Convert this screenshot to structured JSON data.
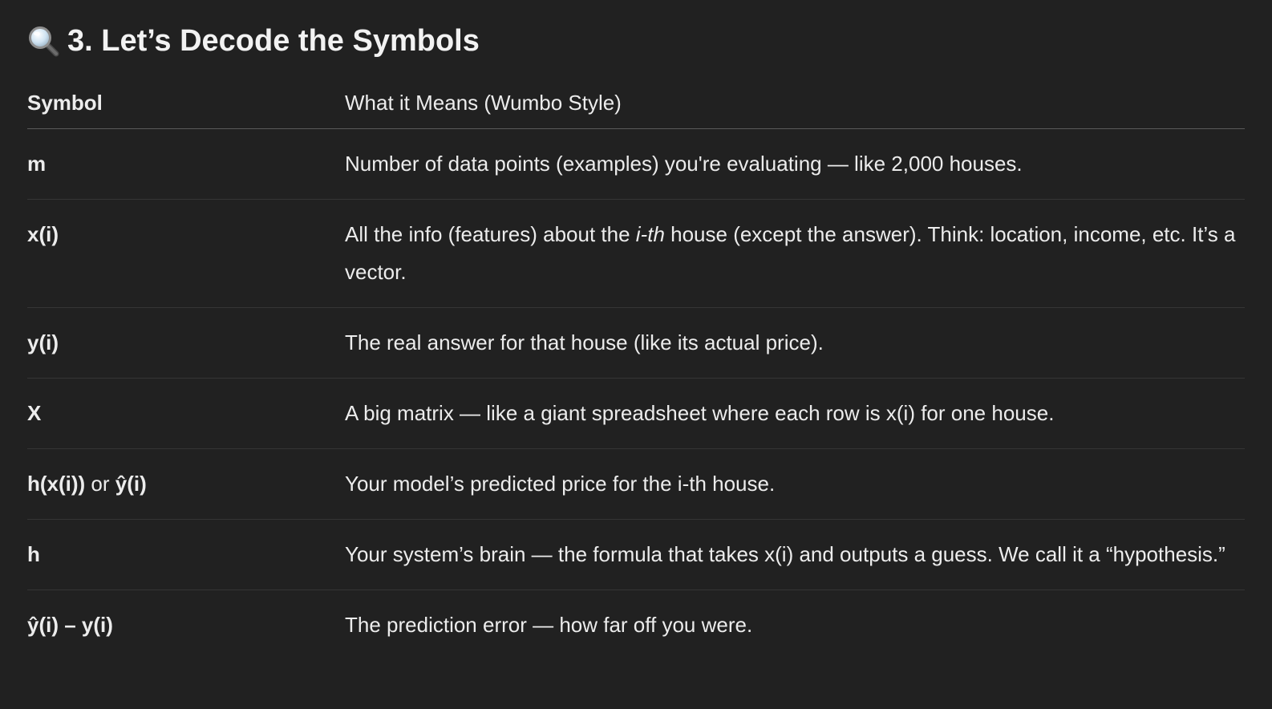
{
  "heading": {
    "number_text": "3. Let’s Decode the Symbols",
    "icon": "magnifying-glass-icon"
  },
  "table": {
    "headers": [
      "Symbol",
      "What it Means (Wumbo Style)"
    ],
    "rows": [
      {
        "symbol": "m",
        "meaning": "Number of data points (examples) you're evaluating — like 2,000 houses."
      },
      {
        "symbol": "x(i)",
        "meaning_pre": "All the info (features) about the ",
        "meaning_em": "i-th",
        "meaning_post": " house (except the answer). Think: location, income, etc. It’s a vector."
      },
      {
        "symbol": "y(i)",
        "meaning": "The real answer for that house (like its actual price)."
      },
      {
        "symbol": "X",
        "meaning": "A big matrix — like a giant spreadsheet where each row is x(i) for one house."
      },
      {
        "symbol_a": "h(x(i))",
        "symbol_or": " or ",
        "symbol_b": "ŷ(i)",
        "meaning": "Your model’s predicted price for the i-th house."
      },
      {
        "symbol": "h",
        "meaning": "Your system’s brain — the formula that takes x(i) and outputs a guess. We call it a “hypothesis.”"
      },
      {
        "symbol": "ŷ(i) – y(i)",
        "meaning": "The prediction error — how far off you were."
      }
    ]
  }
}
